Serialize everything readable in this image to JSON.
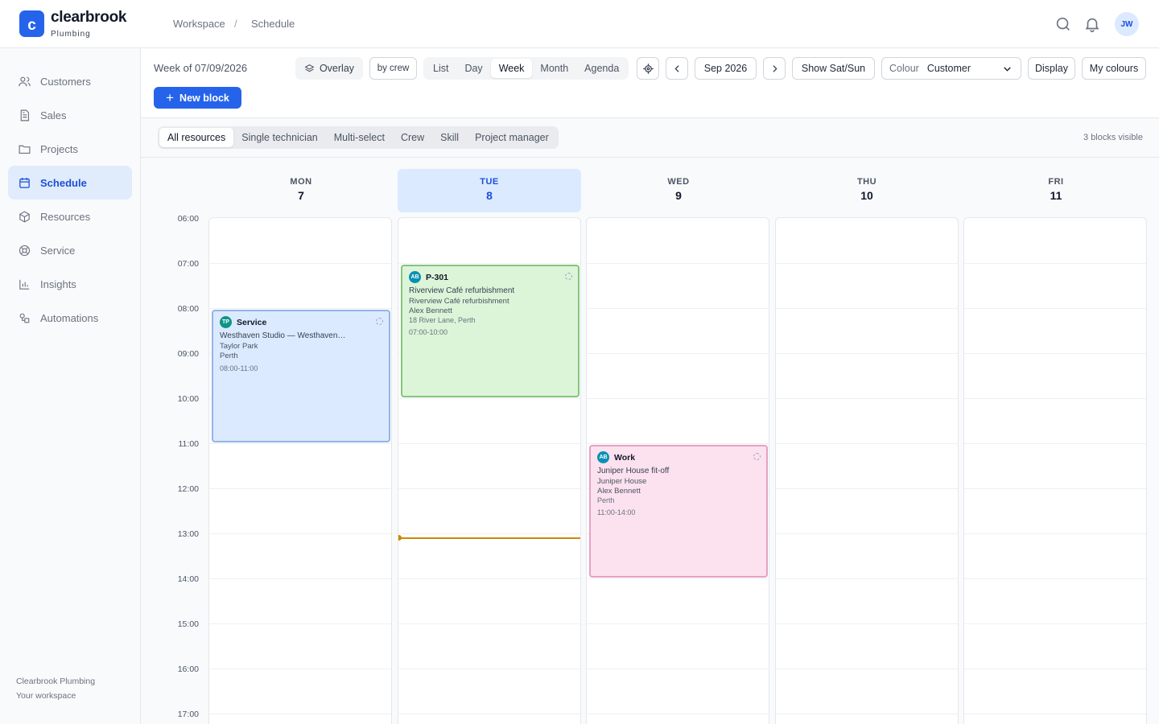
{
  "brand": {
    "name": "clearbrook",
    "sub": "Plumbing",
    "mark": "c"
  },
  "breadcrumb": [
    "Workspace",
    "/",
    "Schedule"
  ],
  "user": {
    "initials": "JW"
  },
  "sidebar": {
    "items": [
      {
        "label": "Customers",
        "icon": "users-icon"
      },
      {
        "label": "Sales",
        "icon": "document-icon"
      },
      {
        "label": "Projects",
        "icon": "folder-icon"
      },
      {
        "label": "Schedule",
        "icon": "calendar-icon",
        "active": true
      },
      {
        "label": "Resources",
        "icon": "box-icon"
      },
      {
        "label": "Service",
        "icon": "lifebuoy-icon"
      },
      {
        "label": "Insights",
        "icon": "bar-chart-icon"
      },
      {
        "label": "Automations",
        "icon": "shapes-icon"
      }
    ],
    "footer": {
      "org": "Clearbrook Plumbing",
      "note": "Your workspace"
    }
  },
  "toolbar": {
    "week_label": "Week of 07/09/2026",
    "overlay": "Overlay",
    "by_crew": "by crew",
    "views": [
      "List",
      "Day",
      "Week",
      "Month",
      "Agenda"
    ],
    "active_view": "Week",
    "period": "Sep 2026",
    "show_weekend": "Show Sat/Sun",
    "colour_label": "Colour",
    "colour_value": "Customer",
    "display": "Display",
    "my_colours": "My colours",
    "new_block": "New block"
  },
  "filters": {
    "options": [
      "All resources",
      "Single technician",
      "Multi-select",
      "Crew",
      "Skill",
      "Project manager"
    ],
    "active": "All resources",
    "count_text": "3 blocks visible"
  },
  "calendar": {
    "days": [
      {
        "name": "MON",
        "num": "7"
      },
      {
        "name": "TUE",
        "num": "8",
        "today": true
      },
      {
        "name": "WED",
        "num": "9"
      },
      {
        "name": "THU",
        "num": "10"
      },
      {
        "name": "FRI",
        "num": "11"
      }
    ],
    "times": [
      "06:00",
      "07:00",
      "08:00",
      "09:00",
      "10:00",
      "11:00",
      "12:00",
      "13:00",
      "14:00",
      "15:00",
      "16:00",
      "17:00"
    ],
    "now_time": "13:05",
    "events": [
      {
        "day": 0,
        "start": "08:00",
        "end": "11:00",
        "badge": "TP",
        "type": "Service",
        "line1": "Westhaven Studio — Westhaven…",
        "line2": "Taylor Park",
        "line3": "Perth",
        "time": "08:00-11:00",
        "bg": "#dbeafe",
        "border": "#93b4e8",
        "badge_color": "#0d9488"
      },
      {
        "day": 1,
        "start": "07:00",
        "end": "10:00",
        "badge": "AB",
        "type": "P-301",
        "line1": "Riverview Café refurbishment",
        "line2": "Riverview Café refurbishment",
        "line3": "Alex Bennett",
        "line3b": "18 River Lane, Perth",
        "time": "07:00-10:00",
        "bg": "#dcf4d8",
        "border": "#86c47d",
        "badge_color": "#0891b2"
      },
      {
        "day": 2,
        "start": "11:00",
        "end": "14:00",
        "badge": "AB",
        "type": "Work",
        "line1": "Juniper House fit-off",
        "line2": "Juniper House",
        "line3": "Alex Bennett",
        "line3b": "Perth",
        "time": "11:00-14:00",
        "bg": "#fce1ef",
        "border": "#e7a1c4",
        "badge_color": "#0891b2"
      }
    ]
  }
}
